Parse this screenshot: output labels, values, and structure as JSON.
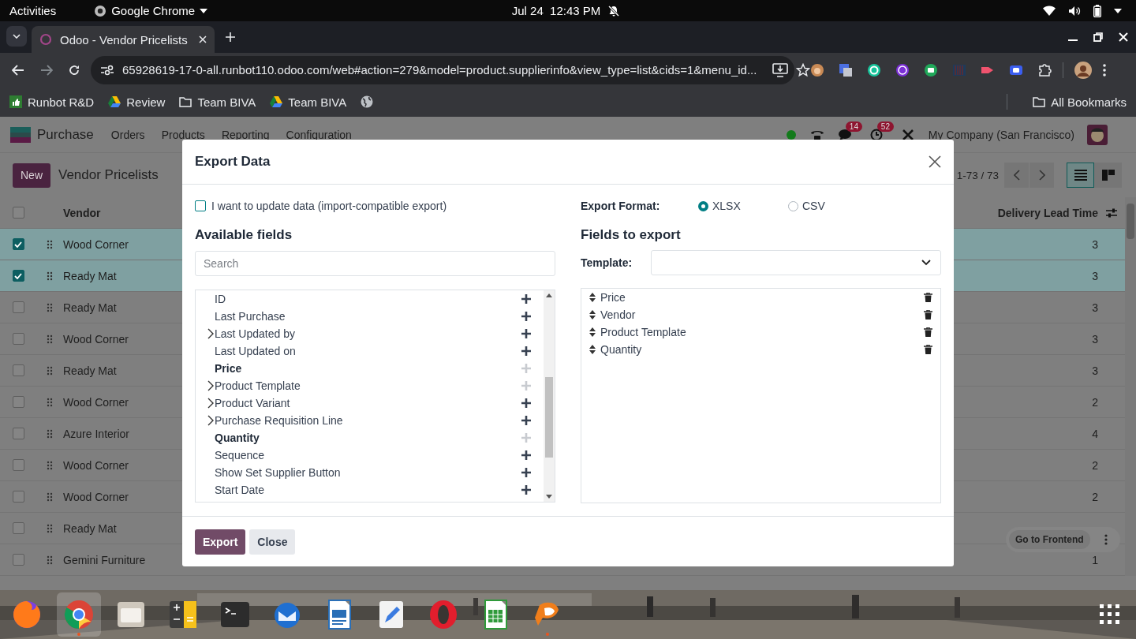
{
  "system_bar": {
    "activities": "Activities",
    "app": "Google Chrome",
    "clock": "Jul 24  12:43 PM"
  },
  "browser": {
    "tab": {
      "title": "Odoo - Vendor Pricelists",
      "selected": true
    },
    "url": "65928619-17-0-all.runbot110.odoo.com/web#action=279&model=product.supplierinfo&view_type=list&cids=1&menu_id...",
    "bookmarks": [
      {
        "label": "Runbot R&D",
        "kind": "thumb"
      },
      {
        "label": "Review",
        "kind": "drive"
      },
      {
        "label": "Team BIVA",
        "kind": "folder"
      },
      {
        "label": "Team BIVA",
        "kind": "drive"
      },
      {
        "kind": "globe"
      }
    ],
    "all_bookmarks": "All Bookmarks"
  },
  "app": {
    "name": "Purchase",
    "menu": [
      "Orders",
      "Products",
      "Reporting",
      "Configuration"
    ],
    "chat_count": "14",
    "activity_count": "52",
    "company": "My Company (San Francisco)"
  },
  "control_panel": {
    "new": "New",
    "title": "Vendor Pricelists",
    "pager": "1-73 / 73",
    "views": [
      {
        "kind": "list",
        "selected": true
      },
      {
        "kind": "kanban",
        "selected": false
      }
    ]
  },
  "list": {
    "columns": [
      "Vendor",
      "Delivery Lead Time"
    ],
    "all_selected": false,
    "rows": [
      {
        "vendor": "Wood Corner",
        "lead_time": "3",
        "selected": true
      },
      {
        "vendor": "Ready Mat",
        "lead_time": "3",
        "selected": true
      },
      {
        "vendor": "Ready Mat",
        "lead_time": "3",
        "selected": false
      },
      {
        "vendor": "Wood Corner",
        "lead_time": "3",
        "selected": false
      },
      {
        "vendor": "Ready Mat",
        "lead_time": "3",
        "selected": false
      },
      {
        "vendor": "Wood Corner",
        "lead_time": "2",
        "selected": false
      },
      {
        "vendor": "Azure Interior",
        "lead_time": "4",
        "selected": false
      },
      {
        "vendor": "Wood Corner",
        "lead_time": "2",
        "selected": false
      },
      {
        "vendor": "Wood Corner",
        "lead_time": "2",
        "selected": false
      },
      {
        "vendor": "Ready Mat",
        "selected": false
      },
      {
        "vendor": "Gemini Furniture",
        "lead_time": "1",
        "selected": false
      }
    ]
  },
  "dialog": {
    "title": "Export Data",
    "import_compatible": {
      "label": "I want to update data (import-compatible export)",
      "checked": false
    },
    "available_title": "Available fields",
    "search_placeholder": "Search",
    "available_fields": [
      {
        "label": "ID",
        "expandable": false,
        "required": false,
        "added": false
      },
      {
        "label": "Last Purchase",
        "expandable": false,
        "required": false,
        "added": false
      },
      {
        "label": "Last Updated by",
        "expandable": true,
        "required": false,
        "added": false
      },
      {
        "label": "Last Updated on",
        "expandable": false,
        "required": false,
        "added": false
      },
      {
        "label": "Price",
        "expandable": false,
        "required": true,
        "added": true
      },
      {
        "label": "Product Template",
        "expandable": true,
        "required": false,
        "added": true
      },
      {
        "label": "Product Variant",
        "expandable": true,
        "required": false,
        "added": false
      },
      {
        "label": "Purchase Requisition Line",
        "expandable": true,
        "required": false,
        "added": false
      },
      {
        "label": "Quantity",
        "expandable": false,
        "required": true,
        "added": true
      },
      {
        "label": "Sequence",
        "expandable": false,
        "required": false,
        "added": false
      },
      {
        "label": "Show Set Supplier Button",
        "expandable": false,
        "required": false,
        "added": false
      },
      {
        "label": "Start Date",
        "expandable": false,
        "required": false,
        "added": false
      }
    ],
    "format_label": "Export Format:",
    "formats": [
      {
        "label": "XLSX",
        "selected": true
      },
      {
        "label": "CSV",
        "selected": false
      }
    ],
    "export_title": "Fields to export",
    "template_label": "Template:",
    "export_fields": [
      "Price",
      "Vendor",
      "Product Template",
      "Quantity"
    ],
    "buttons": [
      {
        "label": "Export",
        "kind": "primary"
      },
      {
        "label": "Close",
        "kind": "secondary"
      }
    ]
  },
  "go_to_frontend": "Go to Frontend",
  "dock": [
    {
      "kind": "firefox",
      "selected": false,
      "running": false
    },
    {
      "kind": "chrome",
      "selected": true,
      "running": true
    },
    {
      "kind": "files",
      "selected": false,
      "running": false
    },
    {
      "kind": "calculator",
      "selected": false,
      "running": false
    },
    {
      "kind": "terminal",
      "selected": false,
      "running": false
    },
    {
      "kind": "mail",
      "selected": false,
      "running": false
    },
    {
      "kind": "writer",
      "selected": false,
      "running": false
    },
    {
      "kind": "editor",
      "selected": false,
      "running": false
    },
    {
      "kind": "opera",
      "selected": false,
      "running": false
    },
    {
      "kind": "sheet",
      "selected": false,
      "running": false
    },
    {
      "kind": "app",
      "selected": false,
      "running": true
    }
  ]
}
